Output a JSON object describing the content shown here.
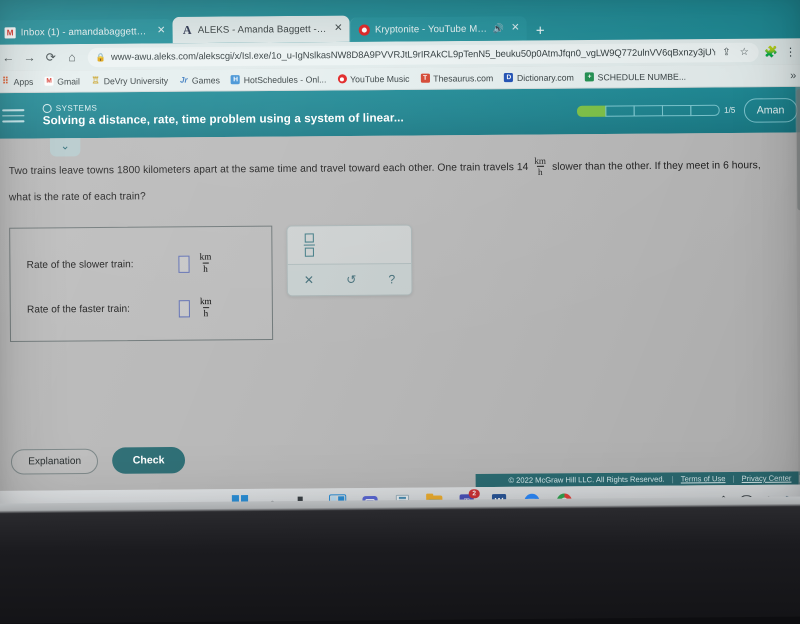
{
  "browser": {
    "tabs": [
      {
        "title": "Inbox (1) - amandabaggett1997@",
        "icon": "gmail-favicon",
        "active": false,
        "close": "✕"
      },
      {
        "title": "ALEKS - Amanda Baggett - Learn",
        "icon": "aleks-favicon",
        "active": true,
        "close": "✕"
      },
      {
        "title": "Kryptonite - YouTube Music",
        "icon": "youtube-music-favicon",
        "active": false,
        "close": "✕",
        "audio": "🔊"
      }
    ],
    "new_tab_label": "+",
    "nav": {
      "back": "←",
      "forward": "→",
      "reload": "⟳",
      "home": "⌂"
    },
    "omnibox": {
      "lock_icon": "🔒",
      "url": "www-awu.aleks.com/alekscgi/x/Isl.exe/1o_u-IgNslkasNW8D8A9PVVRJtL9rIRAkCL9pTenN5_beuku50p0AtmJfqn0_vgLW9Q772ulnVV6qBxnzy3jUY...",
      "share_icon": "⇪",
      "bookmark_icon": "☆"
    },
    "toolbar_right": {
      "extensions_icon": "🧩",
      "menu_icon": "⋮"
    },
    "bookmarks": [
      {
        "label": "Apps",
        "icon": "apps-icon"
      },
      {
        "label": "Gmail",
        "icon": "gmail-icon"
      },
      {
        "label": "DeVry University",
        "icon": "devry-icon"
      },
      {
        "label": "Games",
        "icon": "games-icon"
      },
      {
        "label": "HotSchedules - Onl...",
        "icon": "hotschedules-icon"
      },
      {
        "label": "YouTube Music",
        "icon": "youtube-music-icon"
      },
      {
        "label": "Thesaurus.com",
        "icon": "thesaurus-icon"
      },
      {
        "label": "Dictionary.com",
        "icon": "dictionary-icon"
      },
      {
        "label": "SCHEDULE NUMBE...",
        "icon": "schedule-icon"
      }
    ],
    "bookmarks_overflow": "»"
  },
  "aleks": {
    "menu_icon": "hamburger-icon",
    "category": "SYSTEMS",
    "objective_title": "Solving a distance, rate, time problem using a system of linear...",
    "progress": {
      "segments_total": 5,
      "segments_filled": 1,
      "count_label": "1/5"
    },
    "user_name": "Aman",
    "collapse_chevron": "⌄",
    "problem": {
      "part1": "Two trains leave towns 1800 kilometers apart at the same time and travel toward each other. One train travels 14",
      "unit_numerator": "km",
      "unit_denominator": "h",
      "part2": "slower than the other. If they meet in 6 hours, what is the rate of each train?"
    },
    "answers": {
      "rows": [
        {
          "label": "Rate of the slower train:",
          "value": "",
          "unit_num": "km",
          "unit_den": "h"
        },
        {
          "label": "Rate of the faster train:",
          "value": "",
          "unit_num": "km",
          "unit_den": "h"
        }
      ]
    },
    "mathpad": {
      "fraction_button": "fraction-template",
      "clear_button": "✕",
      "undo_button": "↺",
      "help_button": "?"
    },
    "buttons": {
      "explanation": "Explanation",
      "check": "Check"
    },
    "footer": {
      "copyright": "© 2022 McGraw Hill LLC. All Rights Reserved.",
      "terms": "Terms of Use",
      "privacy": "Privacy Center",
      "separator": "|"
    }
  },
  "taskbar": {
    "items": [
      {
        "name": "start-button",
        "label": "Start"
      },
      {
        "name": "search-button",
        "label": "Search",
        "glyph": "⌕"
      },
      {
        "name": "task-view-button",
        "label": "Task View"
      },
      {
        "name": "widgets-button",
        "label": "Widgets"
      },
      {
        "name": "chat-button",
        "label": "Chat"
      },
      {
        "name": "notes-button",
        "label": "Notes"
      },
      {
        "name": "file-explorer-button",
        "label": "File Explorer"
      },
      {
        "name": "teams-button",
        "label": "Teams",
        "badge": "2",
        "glyph": "T"
      },
      {
        "name": "word-button",
        "label": "Word",
        "glyph": "W"
      },
      {
        "name": "zoom-button",
        "label": "Zoom"
      },
      {
        "name": "chrome-button",
        "label": "Google Chrome"
      }
    ],
    "tray": {
      "chevron": "⌃",
      "cloud": "OneDrive",
      "wifi": "📶",
      "volume": "🔊"
    }
  },
  "colors": {
    "aleks_teal": "#1a818d",
    "tab_teal": "#1e8b96",
    "check_button": "#2c6d74",
    "progress_green": "#7bc043",
    "input_border": "#5f6fb3"
  }
}
